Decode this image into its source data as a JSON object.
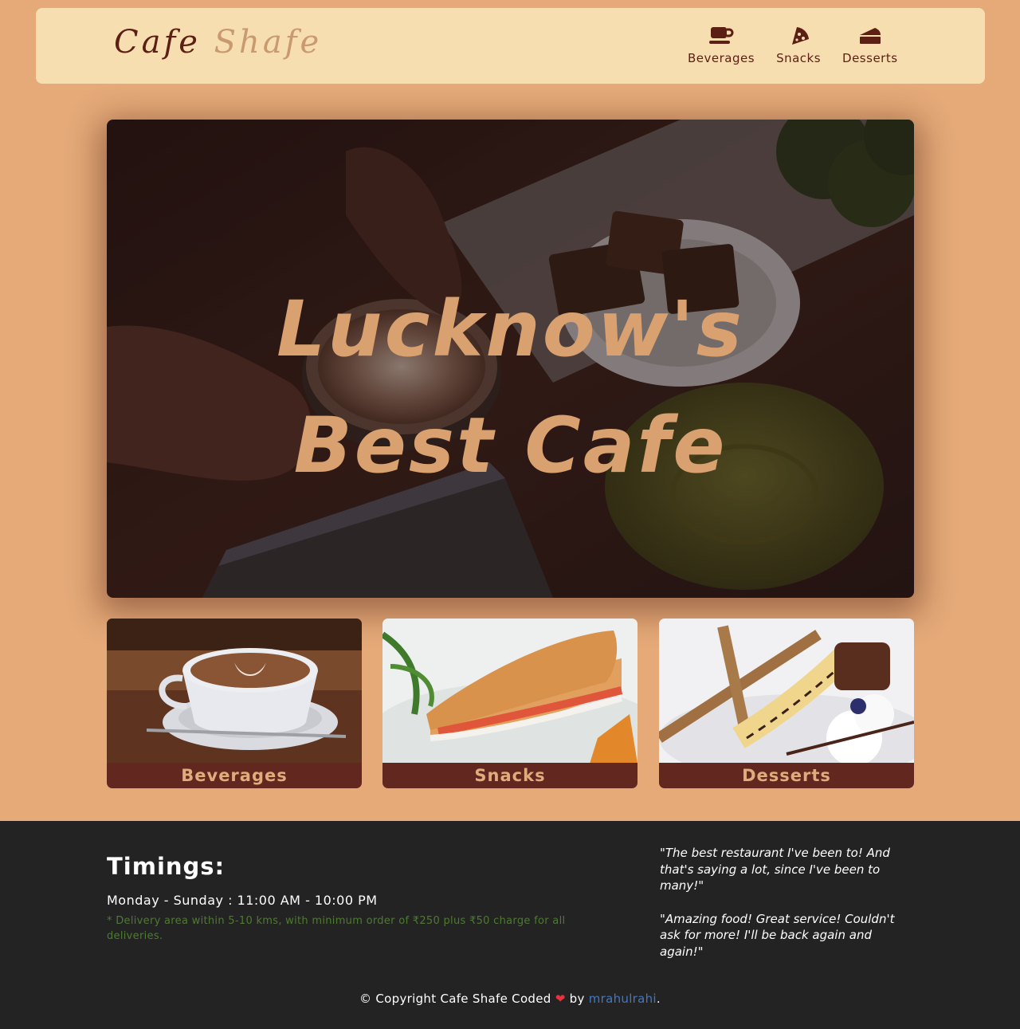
{
  "header": {
    "logo_word1": "Cafe",
    "logo_word2": "Shafe",
    "nav": [
      {
        "label": "Beverages",
        "icon": "coffee-cup-icon"
      },
      {
        "label": "Snacks",
        "icon": "pizza-slice-icon"
      },
      {
        "label": "Desserts",
        "icon": "cake-slice-icon"
      }
    ]
  },
  "hero": {
    "line1": "Lucknow's",
    "line2": "Best Cafe"
  },
  "cards": [
    {
      "label": "Beverages"
    },
    {
      "label": "Snacks"
    },
    {
      "label": "Desserts"
    }
  ],
  "footer": {
    "timings_title": "Timings:",
    "hours": "Monday - Sunday : 11:00 AM - 10:00 PM",
    "note": "* Delivery area within 5-10 kms, with minimum order of ₹250 plus ₹50 charge for all deliveries.",
    "testimonials": [
      "\"The best restaurant I've been to! And that's saying a lot, since I've been to many!\"",
      "\"Amazing food! Great service! Couldn't ask for more! I'll be back again and again!\""
    ],
    "copyright_prefix": "© Copyright Cafe Shafe Coded",
    "heart": "❤",
    "by": "by",
    "author_link": "mrahulrahi",
    "period": "."
  },
  "colors": {
    "page_bg": "#e5aa78",
    "header_bg": "#f6deb1",
    "brand_dark": "#5c1f14",
    "accent": "#d8a16f",
    "card_label_bg": "#62271f",
    "footer_bg": "#232323",
    "note_green": "#4e7a32",
    "link_blue": "#3f78c6"
  }
}
